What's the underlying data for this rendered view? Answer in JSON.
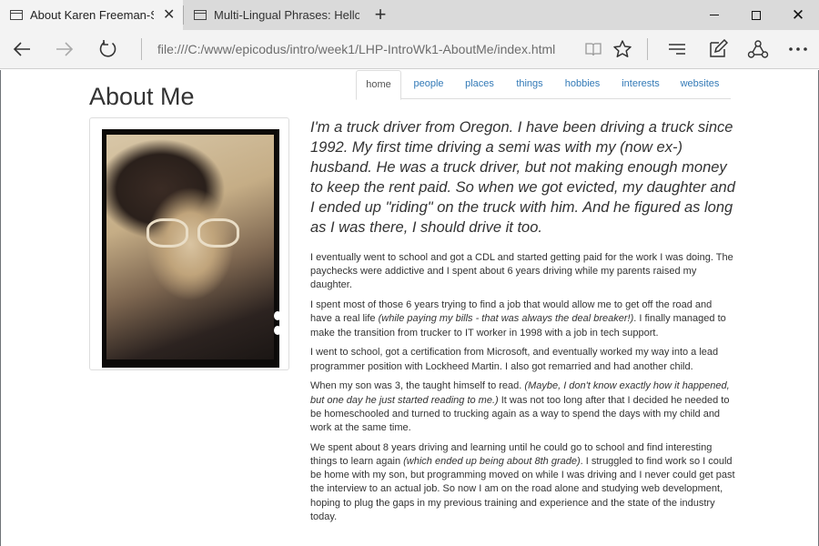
{
  "browser": {
    "tabs": [
      {
        "title": "About Karen Freeman-S",
        "active": true
      },
      {
        "title": "Multi-Lingual Phrases: Hello",
        "active": false
      }
    ],
    "address": "file:///C:/www/epicodus/intro/week1/LHP-IntroWk1-AboutMe/index.html",
    "icons": {
      "back": "back-arrow-icon",
      "forward": "forward-arrow-icon",
      "refresh": "refresh-icon",
      "reading_view": "book-icon",
      "favorite": "star-icon",
      "hub": "hub-icon",
      "web_note": "pen-note-icon",
      "share": "share-icon",
      "more": "more-icon"
    }
  },
  "page": {
    "title": "About Me",
    "nav": [
      "home",
      "people",
      "places",
      "things",
      "hobbies",
      "interests",
      "websites"
    ],
    "active_nav": "home",
    "lead": "I'm a truck driver from Oregon. I have been driving a truck since 1992. My first time driving a semi was with my (now ex-) husband. He was a truck driver, but not making enough money to keep the rent paid. So when we got evicted, my daughter and I ended up \"riding\" on the truck with him. And he figured as long as I was there, I should drive it too.",
    "paragraphs": [
      {
        "a": "I eventually went to school and got a CDL and started getting paid for the work I was doing. The paychecks were addictive and I spent about 6 years driving while my parents raised my daughter.",
        "em": "",
        "b": ""
      },
      {
        "a": "I spent most of those 6 years trying to find a job that would allow me to get off the road and have a real life ",
        "em": "(while paying my bills - that was always the deal breaker!)",
        "b": ". I finally managed to make the transition from trucker to IT worker in 1998 with a job in tech support."
      },
      {
        "a": "I went to school, got a certification from Microsoft, and eventually worked my way into a lead programmer position with Lockheed Martin. I also got remarried and had another child.",
        "em": "",
        "b": ""
      },
      {
        "a": "When my son was 3, the taught himself to read. ",
        "em": "(Maybe, I don't know exactly how it happened, but one day he just started reading to me.)",
        "b": " It was not too long after that I decided he needed to be homeschooled and turned to trucking again as a way to spend the days with my child and work at the same time."
      },
      {
        "a": "We spent about 8 years driving and learning until he could go to school and find interesting things to learn again ",
        "em": "(which ended up being about 8th grade)",
        "b": ". I struggled to find work so I could be home with my son, but programming moved on while I was driving and I never could get past the interview to an actual job. So now I am on the road alone and studying web development, hoping to plug the gaps in my previous training and experience and the state of the industry today."
      }
    ]
  }
}
